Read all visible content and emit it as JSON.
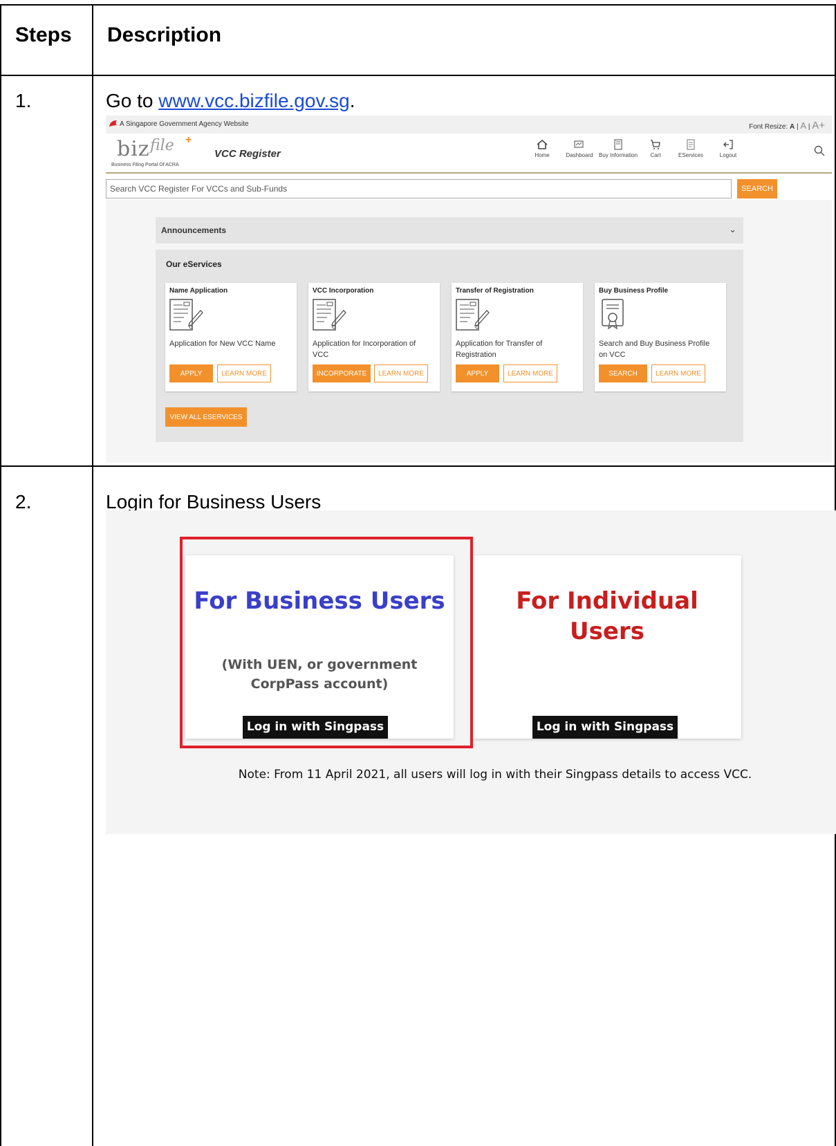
{
  "table": {
    "header_steps": "Steps",
    "header_description": "Description",
    "rows": [
      {
        "step": "1.",
        "desc_prefix": "Go to ",
        "link": "www.vcc.bizfile.gov.sg",
        "desc_suffix": "."
      },
      {
        "step": "2.",
        "desc": "Login for Business Users"
      }
    ]
  },
  "shot1": {
    "gov_bar_text": "A Singapore Government Agency Website",
    "font_resize_label": "Font Resize:",
    "font_resize_options": [
      "A",
      "A",
      "A+"
    ],
    "logo_biz": "biz",
    "logo_file": "file",
    "logo_plus": "+",
    "logo_subtitle": "Business Filing Portal Of ACRA",
    "app_title": "VCC Register",
    "nav": [
      "Home",
      "Dashboard",
      "Buy Information",
      "Cart",
      "EServices",
      "Logout"
    ],
    "search_placeholder": "Search VCC Register For VCCs and Sub-Funds",
    "search_button": "SEARCH",
    "announcements": "Announcements",
    "eservices_title": "Our eServices",
    "cards": [
      {
        "title": "Name Application",
        "desc": "Application for New VCC Name",
        "primary": "APPLY",
        "secondary": "LEARN MORE"
      },
      {
        "title": "VCC Incorporation",
        "desc": "Application for Incorporation of VCC",
        "primary": "INCORPORATE",
        "secondary": "LEARN MORE"
      },
      {
        "title": "Transfer of Registration",
        "desc": "Application for Transfer of Registration",
        "primary": "APPLY",
        "secondary": "LEARN MORE"
      },
      {
        "title": "Buy Business Profile",
        "desc": "Search and Buy Business Profile on VCC",
        "primary": "SEARCH",
        "secondary": "LEARN MORE"
      }
    ],
    "view_all": "VIEW ALL ESERVICES"
  },
  "shot2": {
    "business": {
      "title": "For Business Users",
      "subtitle_line1": "(With UEN, or government",
      "subtitle_line2": "CorpPass account)",
      "button": "Log in with Singpass"
    },
    "individual": {
      "title_line1": "For Individual",
      "title_line2": "Users",
      "button": "Log in with Singpass"
    },
    "note": "Note: From 11 April 2021, all users will log in with their Singpass details to access VCC."
  },
  "colors": {
    "accent_orange": "#f2912c",
    "business_title": "#3a3fc8",
    "individual_title": "#c81e1e",
    "highlight_box": "#e0202a",
    "link": "#1a4bd6"
  }
}
